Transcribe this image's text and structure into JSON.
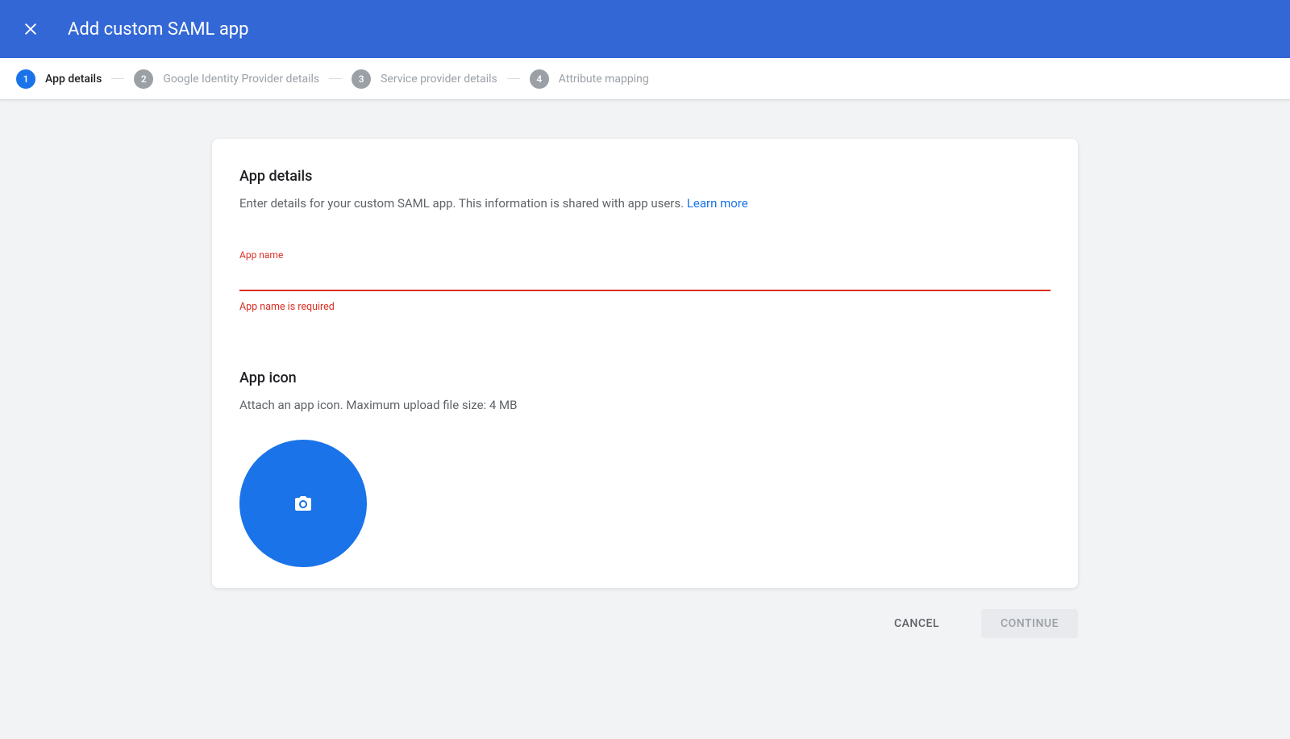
{
  "header": {
    "title": "Add custom SAML app"
  },
  "stepper": {
    "steps": [
      {
        "num": "1",
        "label": "App details"
      },
      {
        "num": "2",
        "label": "Google Identity Provider details"
      },
      {
        "num": "3",
        "label": "Service provider details"
      },
      {
        "num": "4",
        "label": "Attribute mapping"
      }
    ]
  },
  "card": {
    "section1": {
      "title": "App details",
      "description_prefix": "Enter details for your custom SAML app. This information is shared with app users. ",
      "learn_more": "Learn more",
      "field_label": "App name",
      "field_value": "",
      "field_error": "App name is required"
    },
    "section2": {
      "title": "App icon",
      "description": "Attach an app icon. Maximum upload file size: 4 MB"
    }
  },
  "buttons": {
    "cancel": "Cancel",
    "continue": "Continue"
  }
}
